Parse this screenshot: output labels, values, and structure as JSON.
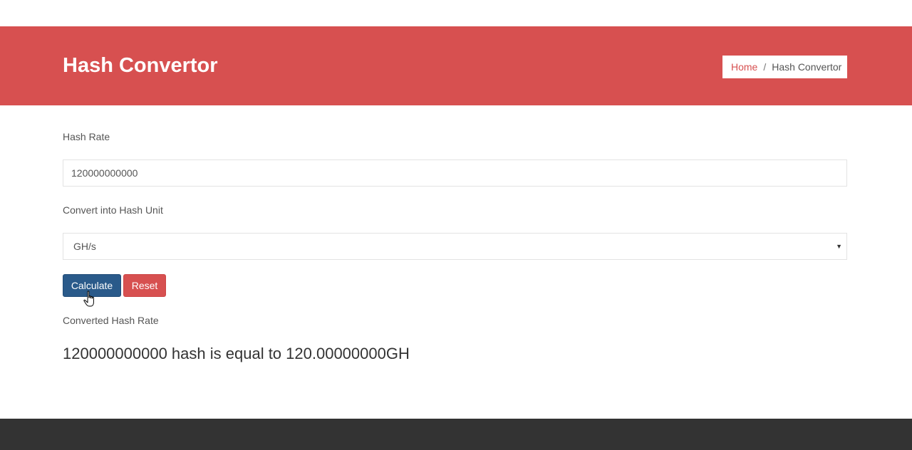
{
  "header": {
    "title": "Hash Convertor",
    "breadcrumb": {
      "home": "Home",
      "separator": "/",
      "current": "Hash Convertor"
    }
  },
  "form": {
    "hash_rate_label": "Hash Rate",
    "hash_rate_value": "120000000000",
    "unit_label": "Convert into Hash Unit",
    "unit_selected": "GH/s",
    "calculate_label": "Calculate",
    "reset_label": "Reset"
  },
  "result": {
    "label": "Converted Hash Rate",
    "text": "120000000000 hash is equal to 120.00000000GH"
  },
  "colors": {
    "accent": "#d75050",
    "primary_button": "#2a5a8a",
    "footer": "#333333"
  },
  "icons": {
    "select_arrow": "chevron-down-icon",
    "cursor": "hand-pointer-icon"
  }
}
